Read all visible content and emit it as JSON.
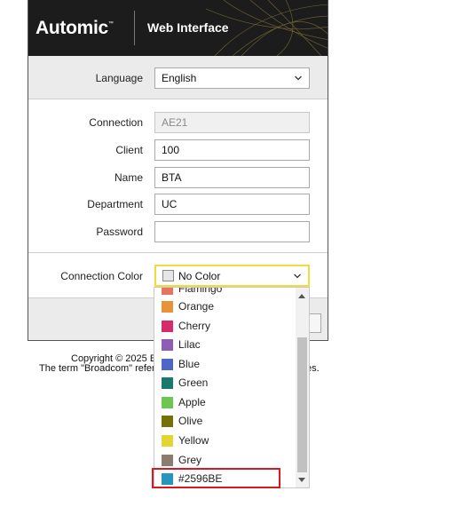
{
  "header": {
    "brand": "Automic",
    "brand_mark": "™",
    "title": "Web Interface"
  },
  "form": {
    "language": {
      "label": "Language",
      "value": "English"
    },
    "connection": {
      "label": "Connection",
      "value": "AE21"
    },
    "client": {
      "label": "Client",
      "value": "100"
    },
    "name": {
      "label": "Name",
      "value": "BTA"
    },
    "department": {
      "label": "Department",
      "value": "UC"
    },
    "password": {
      "label": "Password",
      "value": ""
    },
    "connection_color": {
      "label": "Connection Color",
      "value": "No Color",
      "swatch": "#e6e6e6"
    }
  },
  "footer": {
    "line1": "Copyright © 2025 B",
    "line2": "The term \"Broadcom\" refers",
    "line2_tail": "es."
  },
  "dropdown": {
    "items": [
      {
        "label": "Flamingo",
        "color": "#e9735c"
      },
      {
        "label": "Orange",
        "color": "#e8923a"
      },
      {
        "label": "Cherry",
        "color": "#d62c6b"
      },
      {
        "label": "Lilac",
        "color": "#8e5db5"
      },
      {
        "label": "Blue",
        "color": "#4f66c9"
      },
      {
        "label": "Green",
        "color": "#177a6d"
      },
      {
        "label": "Apple",
        "color": "#6cc64f"
      },
      {
        "label": "Olive",
        "color": "#757007"
      },
      {
        "label": "Yellow",
        "color": "#e3d632"
      },
      {
        "label": "Grey",
        "color": "#8a7c6f"
      },
      {
        "label": "#2596BE",
        "color": "#2596be"
      }
    ]
  }
}
